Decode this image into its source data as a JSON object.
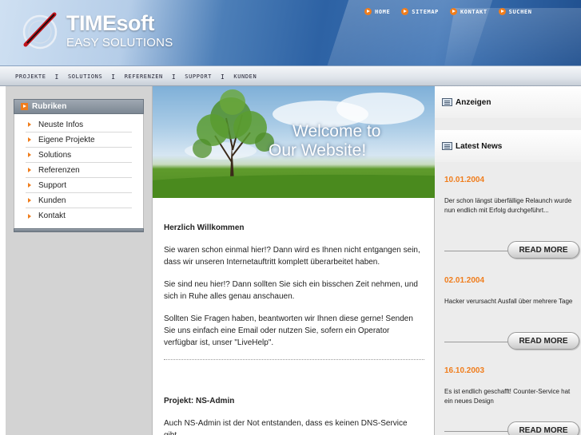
{
  "brand": {
    "title": "TIMEsoft",
    "subtitle": "EASY SOLUTIONS"
  },
  "topnav": [
    {
      "label": "HOME"
    },
    {
      "label": "SITEMAP"
    },
    {
      "label": "KONTAKT"
    },
    {
      "label": "SUCHEN"
    }
  ],
  "subnav": [
    {
      "label": "PROJEKTE"
    },
    {
      "label": "SOLUTIONS"
    },
    {
      "label": "REFERENZEN"
    },
    {
      "label": "SUPPORT"
    },
    {
      "label": "KUNDEN"
    }
  ],
  "subnav_separator": "I",
  "sidebar": {
    "heading": "Rubriken",
    "items": [
      {
        "label": "Neuste Infos"
      },
      {
        "label": "Eigene Projekte"
      },
      {
        "label": "Solutions"
      },
      {
        "label": "Referenzen"
      },
      {
        "label": "Support"
      },
      {
        "label": "Kunden"
      },
      {
        "label": "Kontakt"
      }
    ]
  },
  "hero": {
    "line1": "Welcome to",
    "line2": "Our Website!"
  },
  "content": {
    "welcome_heading": "Herzlich Willkommen",
    "paragraphs": [
      "Sie waren schon einmal hier!? Dann wird es Ihnen nicht entgangen sein, dass wir unseren Internetauftritt komplett überarbeitet haben.",
      "Sie sind neu hier!? Dann sollten Sie sich ein bisschen Zeit nehmen, und sich in Ruhe alles genau anschauen.",
      "Sollten Sie Fragen haben, beantworten wir Ihnen diese gerne! Senden Sie uns einfach eine Email oder nutzen Sie, sofern ein Operator verfügbar ist, unser \"LiveHelp\"."
    ],
    "project_heading": "Projekt: NS-Admin",
    "project_text": "Auch NS-Admin ist der Not entstanden, dass es keinen DNS-Service gibt,"
  },
  "right": {
    "ads_heading": "Anzeigen",
    "news_heading": "Latest News",
    "read_more_label": "READ MORE",
    "news": [
      {
        "date": "10.01.2004",
        "text": "Der schon längst überfällige Relaunch wurde nun endlich mit Erfolg durchgeführt..."
      },
      {
        "date": "02.01.2004",
        "text": "Hacker verursacht Ausfall über mehrere Tage"
      },
      {
        "date": "16.10.2003",
        "text": "Es ist endlich geschafft! Counter-Service hat ein neues Design"
      }
    ]
  },
  "colors": {
    "accent_orange": "#f07d1c",
    "header_blue": "#2d62a4",
    "sidebar_gray": "#d3d3d3"
  }
}
